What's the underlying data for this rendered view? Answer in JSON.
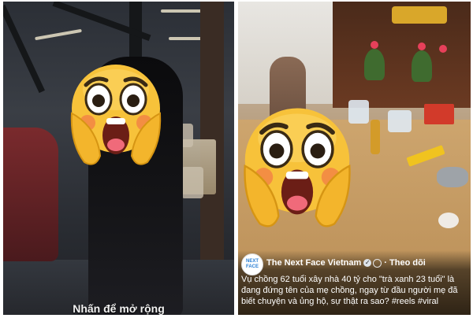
{
  "left_panel": {
    "expand_label": "Nhấn để mở rộng"
  },
  "right_panel": {
    "page_avatar_line1": "NEXT",
    "page_avatar_line2": "FACE",
    "page_name": "The Next Face Vietnam",
    "separator": "·",
    "follow_label": "Theo dõi",
    "caption": "Vụ chồng 62 tuổi xây nhà 40 tỷ cho \"trà xanh 23 tuổi\" là đang đứng tên của mẹ chồng, ngay từ đầu người mẹ đã biết chuyện và ủng hộ, sự thật ra sao? #reels #viral"
  },
  "colors": {
    "emoji_face": "#f7c23a",
    "emoji_cheeks": "#f06a4a",
    "accent_blue": "#2a7fd4"
  },
  "icons": [
    "shocked-face-emoji",
    "verified-badge-icon",
    "globe-icon"
  ]
}
